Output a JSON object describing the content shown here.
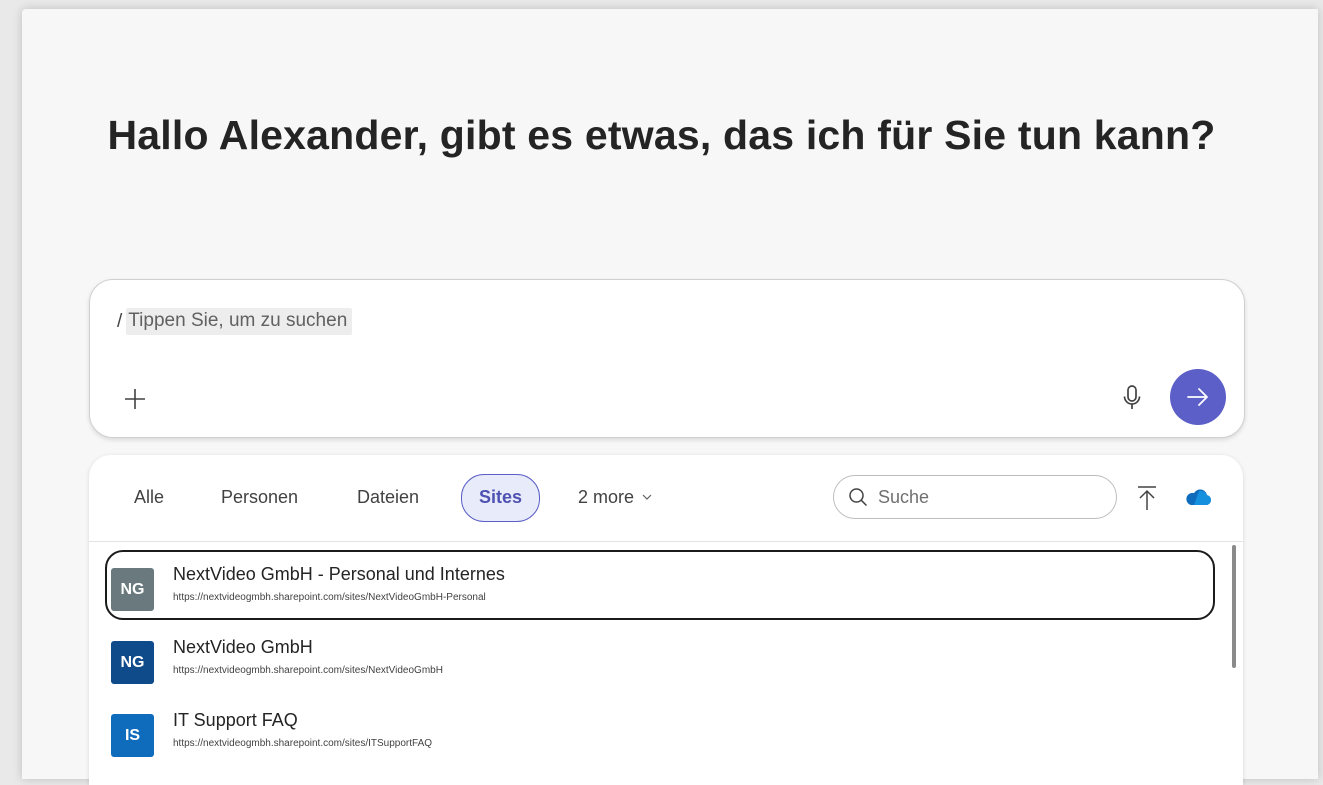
{
  "greeting": "Hallo Alexander, gibt es etwas, das ich für Sie tun kann?",
  "composer": {
    "slash": "/",
    "hint": "Tippen Sie, um zu suchen",
    "send_color": "#5b5fc7"
  },
  "filters": {
    "tabs": [
      {
        "label": "Alle"
      },
      {
        "label": "Personen"
      },
      {
        "label": "Dateien"
      },
      {
        "label": "Sites",
        "selected": true
      },
      {
        "label": "2 more"
      }
    ],
    "search_placeholder": "Suche"
  },
  "sites": [
    {
      "initials": "NG",
      "title": "NextVideo GmbH - Personal und Internes",
      "url": "https://nextvideogmbh.sharepoint.com/sites/NextVideoGmbH-Personal",
      "color": "#69797e",
      "focused": true
    },
    {
      "initials": "NG",
      "title": "NextVideo GmbH",
      "url": "https://nextvideogmbh.sharepoint.com/sites/NextVideoGmbH",
      "color": "#0f4a8a"
    },
    {
      "initials": "IS",
      "title": "IT Support FAQ",
      "url": "https://nextvideogmbh.sharepoint.com/sites/ITSupportFAQ",
      "color": "#0f6cbd"
    }
  ],
  "icons": {
    "add": "plus-icon",
    "mic": "microphone-icon",
    "send": "arrow-right-icon",
    "search": "search-icon",
    "upload": "upload-icon",
    "cloud": "onedrive-cloud-icon",
    "more": "chevron-down-icon"
  }
}
